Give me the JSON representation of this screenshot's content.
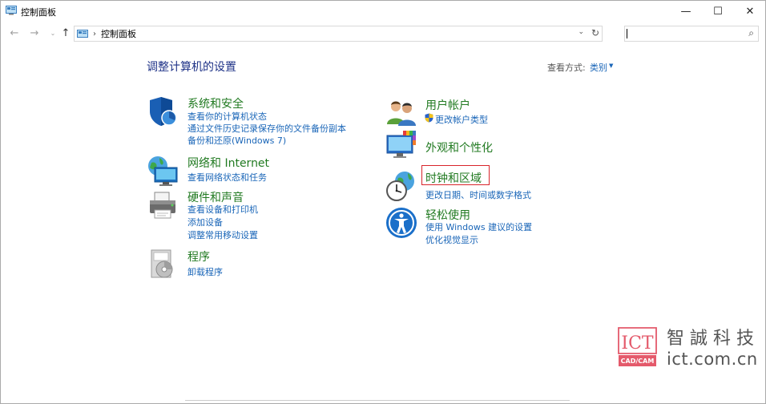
{
  "window": {
    "title": "控制面板",
    "controls": {
      "minimize": "—",
      "maximize": "☐",
      "close": "✕"
    }
  },
  "navbar": {
    "back": "←",
    "forward": "→",
    "recent": "⌄",
    "up": "↑",
    "breadcrumb_separator": "›",
    "breadcrumb": "控制面板",
    "dropdown": "⌄",
    "refresh": "↻",
    "search_value": "",
    "search_icon": "⌕"
  },
  "main": {
    "title": "调整计算机的设置",
    "view_by_label": "查看方式:",
    "view_by_value": "类别",
    "view_by_caret": "▼"
  },
  "categories_left": [
    {
      "title": "系统和安全",
      "icon": "shield-icon",
      "links": [
        "查看你的计算机状态",
        "通过文件历史记录保存你的文件备份副本",
        "备份和还原(Windows 7)"
      ]
    },
    {
      "title": "网络和 Internet",
      "icon": "network-globe-icon",
      "links": [
        "查看网络状态和任务"
      ]
    },
    {
      "title": "硬件和声音",
      "icon": "printer-icon",
      "links": [
        "查看设备和打印机",
        "添加设备",
        "调整常用移动设置"
      ]
    },
    {
      "title": "程序",
      "icon": "programs-disc-icon",
      "links": [
        "卸载程序"
      ]
    }
  ],
  "categories_right": [
    {
      "title": "用户帐户",
      "icon": "users-icon",
      "links": [
        "更改帐户类型"
      ]
    },
    {
      "title": "外观和个性化",
      "icon": "monitor-palette-icon",
      "links": []
    },
    {
      "title": "时钟和区域",
      "icon": "clock-globe-icon",
      "links": [
        "更改日期、时间或数字格式"
      ]
    },
    {
      "title": "轻松使用",
      "icon": "ease-of-access-icon",
      "links": [
        "使用 Windows 建议的设置",
        "优化视觉显示"
      ]
    }
  ],
  "watermark": {
    "logo_text": "ICT",
    "logo_sub": "CAD/CAM",
    "line1": "智誠科技",
    "line2": "ict.com.cn"
  },
  "colors": {
    "category_title": "#217a21",
    "link": "#1a66b8",
    "page_title": "#1e3287",
    "highlight": "#d8252b"
  }
}
